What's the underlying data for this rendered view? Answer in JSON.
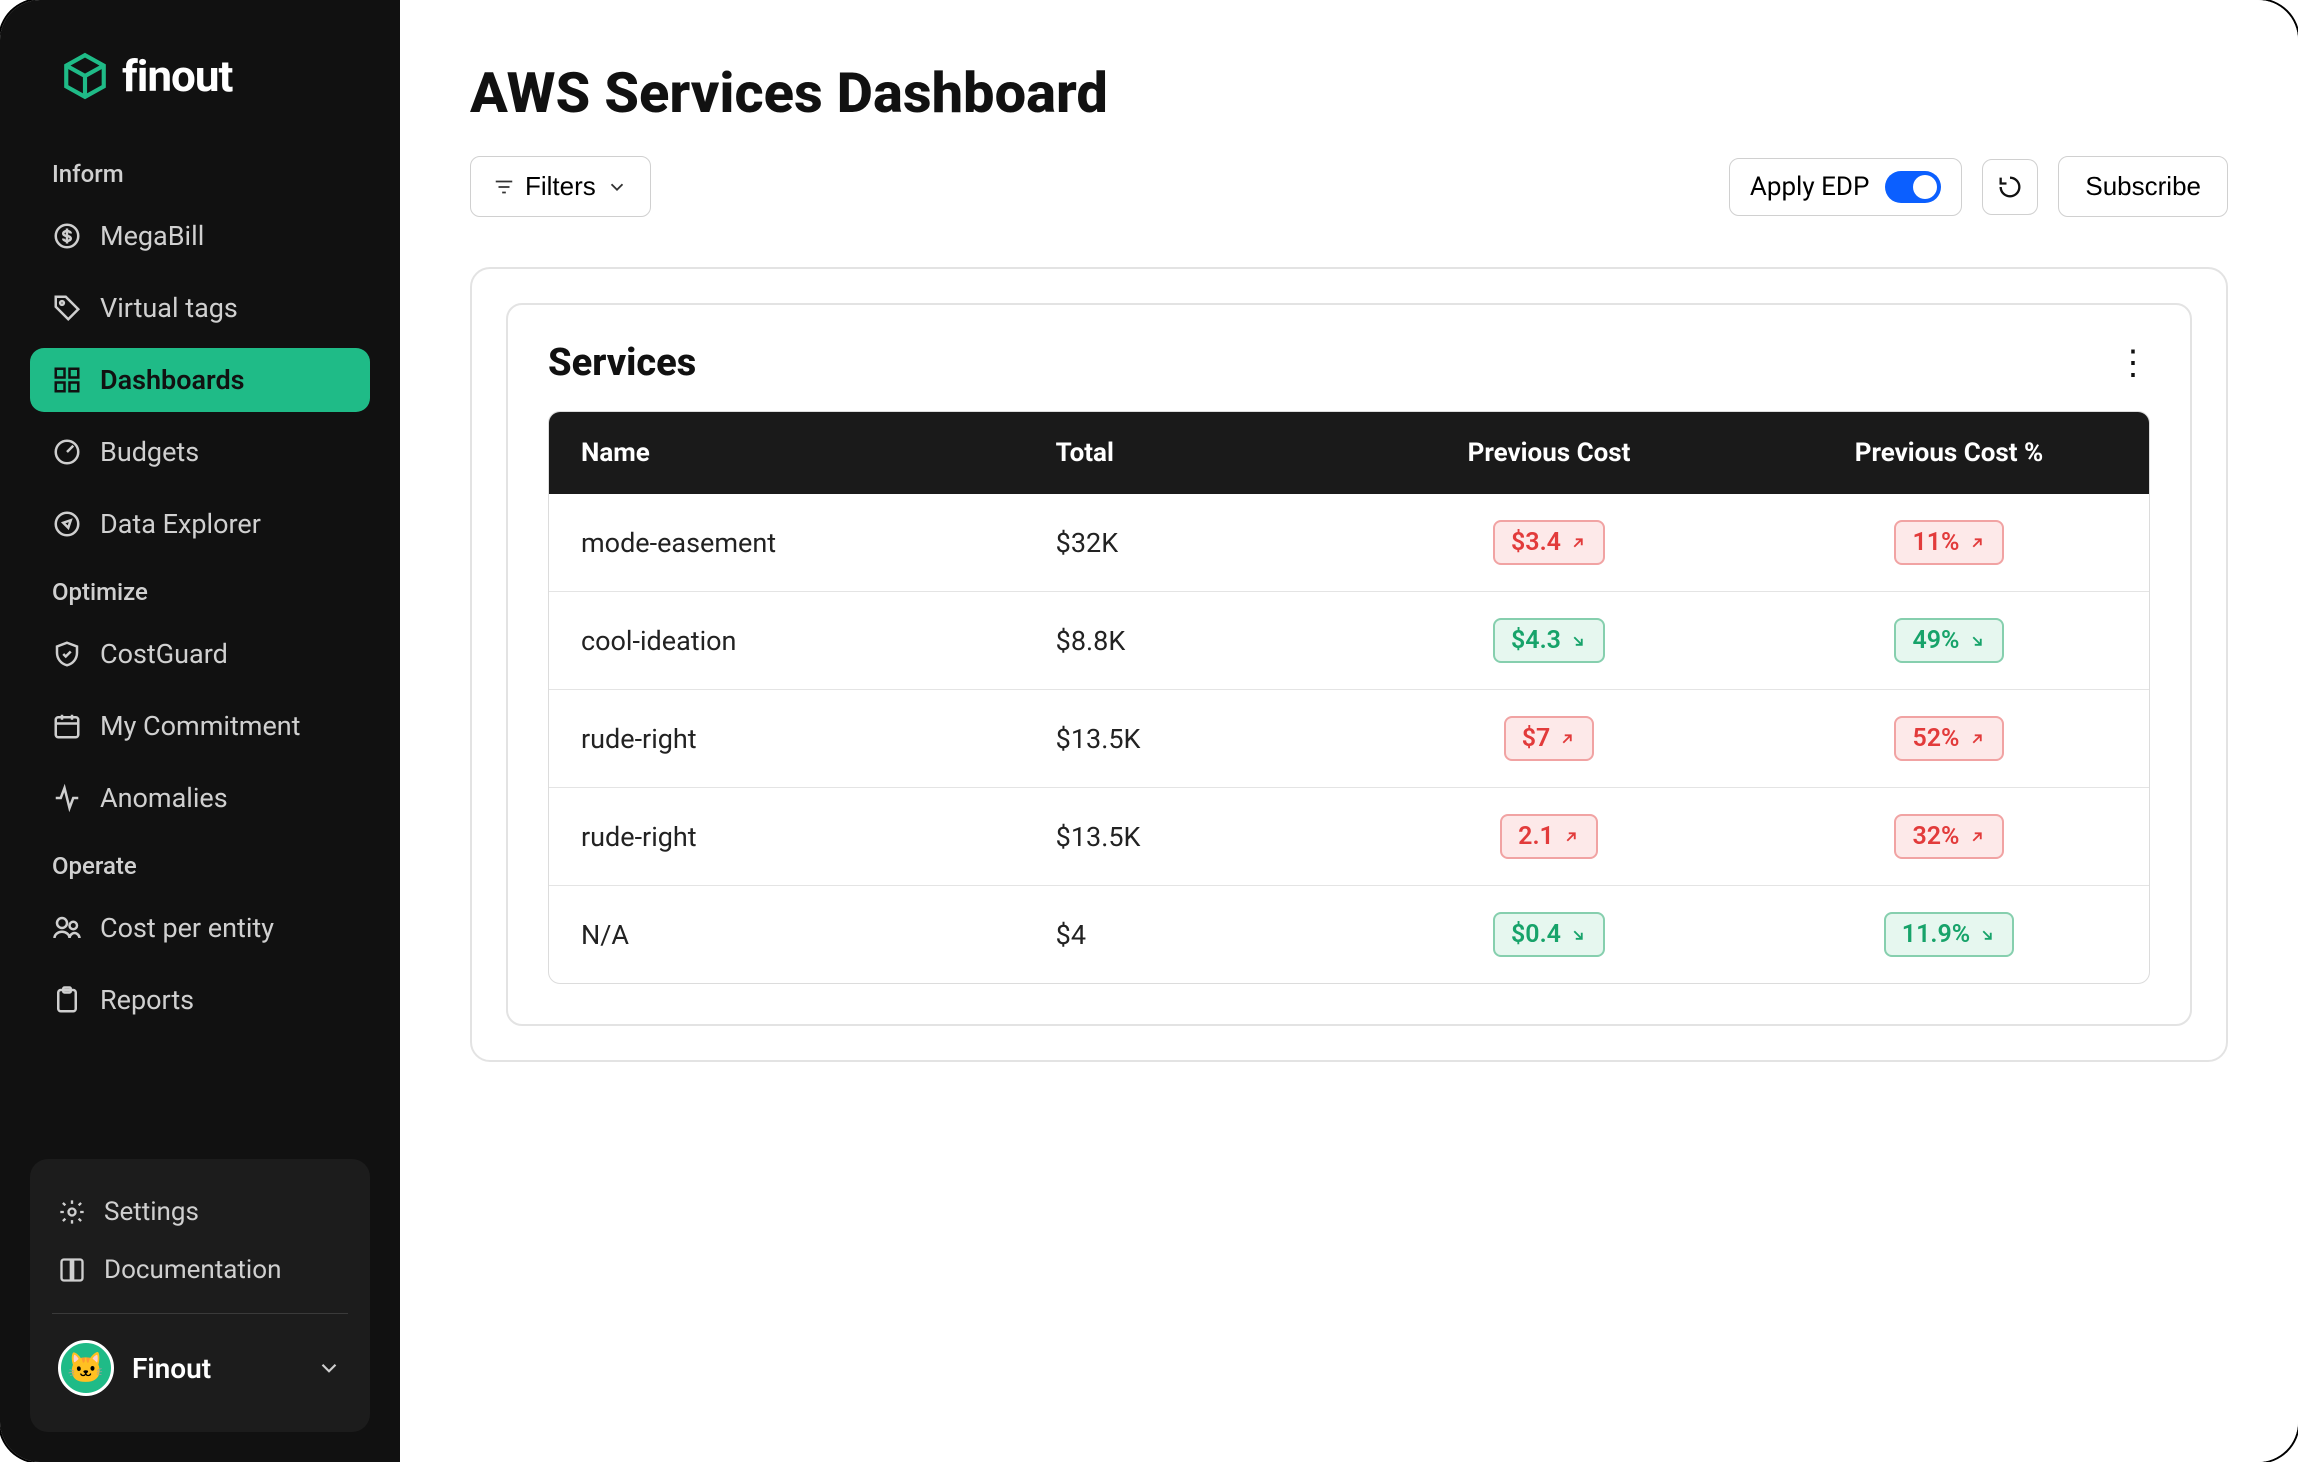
{
  "brand": {
    "name": "finout"
  },
  "sidebar": {
    "sections": [
      {
        "label": "Inform",
        "items": [
          {
            "icon": "megabill-icon",
            "label": "MegaBill"
          },
          {
            "icon": "tag-icon",
            "label": "Virtual tags"
          },
          {
            "icon": "dashboard-icon",
            "label": "Dashboards",
            "active": true
          },
          {
            "icon": "gauge-icon",
            "label": "Budgets"
          },
          {
            "icon": "compass-icon",
            "label": "Data Explorer"
          }
        ]
      },
      {
        "label": "Optimize",
        "items": [
          {
            "icon": "shield-check-icon",
            "label": "CostGuard"
          },
          {
            "icon": "calendar-icon",
            "label": "My Commitment"
          },
          {
            "icon": "activity-icon",
            "label": "Anomalies"
          }
        ]
      },
      {
        "label": "Operate",
        "items": [
          {
            "icon": "users-icon",
            "label": "Cost per entity"
          },
          {
            "icon": "clipboard-icon",
            "label": "Reports"
          }
        ]
      }
    ],
    "footer": {
      "settings": "Settings",
      "documentation": "Documentation",
      "account_name": "Finout"
    }
  },
  "page": {
    "title": "AWS Services Dashboard",
    "filters_label": "Filters",
    "apply_edp_label": "Apply EDP",
    "subscribe_label": "Subscribe"
  },
  "services_panel": {
    "title": "Services",
    "columns": {
      "name": "Name",
      "total": "Total",
      "prev": "Previous Cost",
      "prevpct": "Previous Cost %"
    },
    "rows": [
      {
        "name": "mode-easement",
        "total": "$32K",
        "prev": "$3.4",
        "prev_dir": "up",
        "prevpct": "11%",
        "prevpct_dir": "up"
      },
      {
        "name": "cool-ideation",
        "total": "$8.8K",
        "prev": "$4.3",
        "prev_dir": "down",
        "prevpct": "49%",
        "prevpct_dir": "down"
      },
      {
        "name": "rude-right",
        "total": "$13.5K",
        "prev": "$7",
        "prev_dir": "up",
        "prevpct": "52%",
        "prevpct_dir": "up"
      },
      {
        "name": "rude-right",
        "total": "$13.5K",
        "prev": "2.1",
        "prev_dir": "up",
        "prevpct": "32%",
        "prevpct_dir": "up"
      },
      {
        "name": "N/A",
        "total": "$4",
        "prev": "$0.4",
        "prev_dir": "down",
        "prevpct": "11.9%",
        "prevpct_dir": "down"
      }
    ]
  }
}
